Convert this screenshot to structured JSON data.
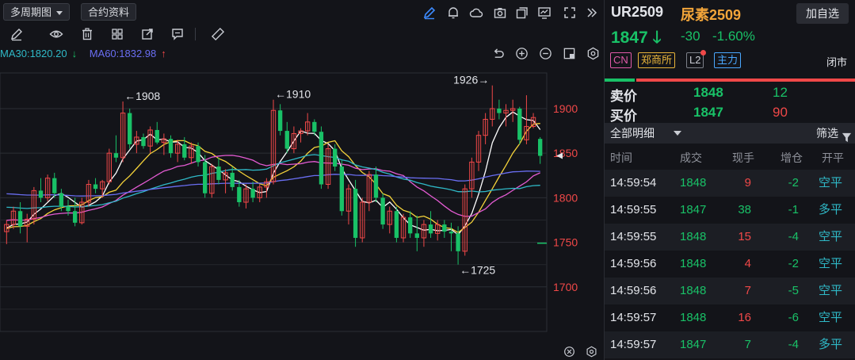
{
  "toolbar": {
    "period_label": "多周期图",
    "contract_label": "合约资料"
  },
  "indicators": {
    "ma30_label": "MA30:1820.20",
    "ma60_label": "MA60:1832.98",
    "ma30_color": "#2fb9c7",
    "ma60_color": "#6a6ef2"
  },
  "chart_data": {
    "type": "candlestick",
    "y_ticks": [
      "1900",
      "1850",
      "1800",
      "1750",
      "1700"
    ],
    "ylim": [
      1650,
      1940
    ],
    "current_price": 1847,
    "annotations": [
      {
        "text": "←1908",
        "value": 1908
      },
      {
        "text": "←1910",
        "value": 1910
      },
      {
        "text": "1926→",
        "value": 1926
      },
      {
        "text": "←1725",
        "value": 1725
      }
    ],
    "candles": [
      [
        1762,
        1775,
        1748,
        1770
      ],
      [
        1770,
        1790,
        1765,
        1785
      ],
      [
        1785,
        1795,
        1760,
        1768
      ],
      [
        1768,
        1782,
        1750,
        1776
      ],
      [
        1776,
        1812,
        1770,
        1808
      ],
      [
        1808,
        1822,
        1795,
        1800
      ],
      [
        1800,
        1826,
        1796,
        1822
      ],
      [
        1822,
        1828,
        1800,
        1805
      ],
      [
        1805,
        1810,
        1785,
        1790
      ],
      [
        1790,
        1798,
        1780,
        1785
      ],
      [
        1785,
        1800,
        1768,
        1772
      ],
      [
        1772,
        1800,
        1770,
        1795
      ],
      [
        1795,
        1820,
        1790,
        1815
      ],
      [
        1815,
        1822,
        1805,
        1810
      ],
      [
        1810,
        1820,
        1800,
        1818
      ],
      [
        1818,
        1855,
        1815,
        1850
      ],
      [
        1850,
        1870,
        1840,
        1845
      ],
      [
        1845,
        1908,
        1840,
        1895
      ],
      [
        1895,
        1900,
        1855,
        1860
      ],
      [
        1860,
        1875,
        1850,
        1868
      ],
      [
        1868,
        1872,
        1855,
        1858
      ],
      [
        1858,
        1880,
        1850,
        1876
      ],
      [
        1876,
        1885,
        1860,
        1862
      ],
      [
        1862,
        1872,
        1848,
        1866
      ],
      [
        1866,
        1870,
        1845,
        1850
      ],
      [
        1850,
        1865,
        1840,
        1860
      ],
      [
        1860,
        1868,
        1842,
        1845
      ],
      [
        1845,
        1862,
        1838,
        1858
      ],
      [
        1858,
        1862,
        1835,
        1840
      ],
      [
        1840,
        1848,
        1800,
        1805
      ],
      [
        1805,
        1838,
        1800,
        1835
      ],
      [
        1835,
        1845,
        1815,
        1820
      ],
      [
        1820,
        1832,
        1805,
        1828
      ],
      [
        1828,
        1835,
        1808,
        1812
      ],
      [
        1812,
        1820,
        1790,
        1795
      ],
      [
        1795,
        1815,
        1788,
        1810
      ],
      [
        1810,
        1818,
        1795,
        1800
      ],
      [
        1800,
        1815,
        1795,
        1812
      ],
      [
        1812,
        1822,
        1800,
        1818
      ],
      [
        1818,
        1910,
        1815,
        1898
      ],
      [
        1898,
        1905,
        1870,
        1875
      ],
      [
        1875,
        1885,
        1850,
        1855
      ],
      [
        1855,
        1880,
        1850,
        1872
      ],
      [
        1872,
        1878,
        1862,
        1875
      ],
      [
        1875,
        1895,
        1870,
        1885
      ],
      [
        1885,
        1888,
        1870,
        1874
      ],
      [
        1874,
        1880,
        1810,
        1815
      ],
      [
        1815,
        1860,
        1810,
        1855
      ],
      [
        1855,
        1860,
        1830,
        1835
      ],
      [
        1835,
        1842,
        1780,
        1785
      ],
      [
        1785,
        1815,
        1770,
        1810
      ],
      [
        1810,
        1820,
        1745,
        1755
      ],
      [
        1755,
        1800,
        1750,
        1795
      ],
      [
        1795,
        1830,
        1785,
        1826
      ],
      [
        1826,
        1835,
        1795,
        1800
      ],
      [
        1800,
        1805,
        1765,
        1770
      ],
      [
        1770,
        1790,
        1760,
        1785
      ],
      [
        1785,
        1790,
        1750,
        1755
      ],
      [
        1755,
        1782,
        1750,
        1778
      ],
      [
        1778,
        1785,
        1755,
        1760
      ],
      [
        1760,
        1780,
        1740,
        1755
      ],
      [
        1755,
        1775,
        1745,
        1770
      ],
      [
        1770,
        1785,
        1755,
        1760
      ],
      [
        1760,
        1775,
        1752,
        1770
      ],
      [
        1770,
        1775,
        1755,
        1762
      ],
      [
        1762,
        1772,
        1740,
        1760
      ],
      [
        1760,
        1768,
        1725,
        1740
      ],
      [
        1740,
        1815,
        1735,
        1810
      ],
      [
        1810,
        1845,
        1800,
        1840
      ],
      [
        1840,
        1875,
        1830,
        1870
      ],
      [
        1870,
        1895,
        1860,
        1888
      ],
      [
        1888,
        1926,
        1880,
        1900
      ],
      [
        1900,
        1910,
        1888,
        1895
      ],
      [
        1895,
        1905,
        1880,
        1898
      ],
      [
        1898,
        1910,
        1885,
        1900
      ],
      [
        1900,
        1902,
        1860,
        1865
      ],
      [
        1865,
        1915,
        1860,
        1880
      ],
      [
        1880,
        1895,
        1878,
        1890
      ],
      [
        1866,
        1868,
        1838,
        1847
      ]
    ]
  },
  "quote": {
    "code": "UR2509",
    "name": "尿素2509",
    "add_label": "加自选",
    "last_price": "1847",
    "change": "-30",
    "change_pct": "-1.60%",
    "tags": [
      "CN",
      "郑商所",
      "L2",
      "主力"
    ],
    "status": "闭市",
    "ask_label": "卖价",
    "ask_price": "1848",
    "ask_vol": "12",
    "bid_label": "买价",
    "bid_price": "1847",
    "bid_vol": "90",
    "up_color": "#f04848",
    "down_color": "#19c167"
  },
  "ticks": {
    "title": "全部明细",
    "filter_label": "筛选",
    "columns": [
      "时间",
      "成交",
      "现手",
      "增仓",
      "开平"
    ],
    "rows": [
      {
        "time": "14:59:54",
        "price": "1848",
        "qty": "9",
        "oi": "-2",
        "type": "空平",
        "qty_color": "#f04848",
        "type_color": "#2fb9c7"
      },
      {
        "time": "14:59:55",
        "price": "1847",
        "qty": "38",
        "oi": "-1",
        "type": "多平",
        "qty_color": "#19c167",
        "type_color": "#2fb9c7"
      },
      {
        "time": "14:59:55",
        "price": "1848",
        "qty": "15",
        "oi": "-4",
        "type": "空平",
        "qty_color": "#f04848",
        "type_color": "#2fb9c7"
      },
      {
        "time": "14:59:56",
        "price": "1848",
        "qty": "4",
        "oi": "-2",
        "type": "空平",
        "qty_color": "#f04848",
        "type_color": "#2fb9c7"
      },
      {
        "time": "14:59:56",
        "price": "1848",
        "qty": "7",
        "oi": "-5",
        "type": "空平",
        "qty_color": "#f04848",
        "type_color": "#2fb9c7"
      },
      {
        "time": "14:59:57",
        "price": "1848",
        "qty": "16",
        "oi": "-6",
        "type": "空平",
        "qty_color": "#f04848",
        "type_color": "#2fb9c7"
      },
      {
        "time": "14:59:57",
        "price": "1847",
        "qty": "7",
        "oi": "-4",
        "type": "多平",
        "qty_color": "#19c167",
        "type_color": "#2fb9c7"
      }
    ]
  }
}
